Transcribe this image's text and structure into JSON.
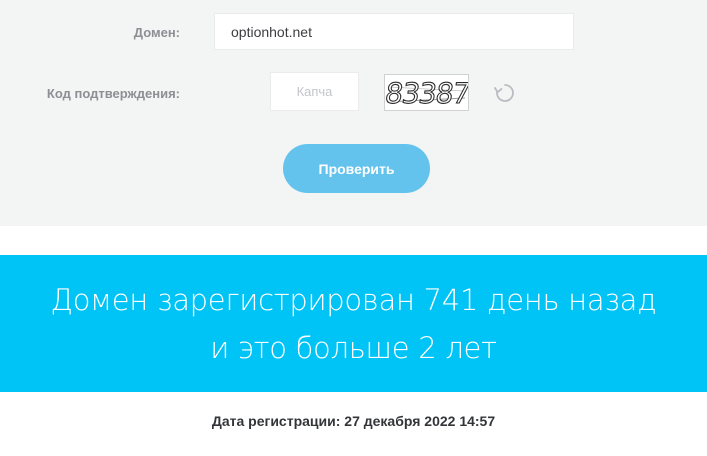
{
  "form": {
    "domain_label": "Домен:",
    "domain_value": "optionhot.net",
    "code_label": "Код подтверждения:",
    "captcha_placeholder": "Капча",
    "captcha_text": "83387",
    "check_button": "Проверить"
  },
  "result": {
    "line1": "Домен зарегистрирован 741 день назад",
    "line2": "и это больше 2 лет",
    "registration_date": "Дата регистрации: 27 декабря 2022 14:57"
  },
  "colors": {
    "panel_bg": "#f3f4f4",
    "button": "#63c3ec",
    "banner": "#00c3f6"
  },
  "icons": {
    "refresh": "refresh-icon"
  }
}
